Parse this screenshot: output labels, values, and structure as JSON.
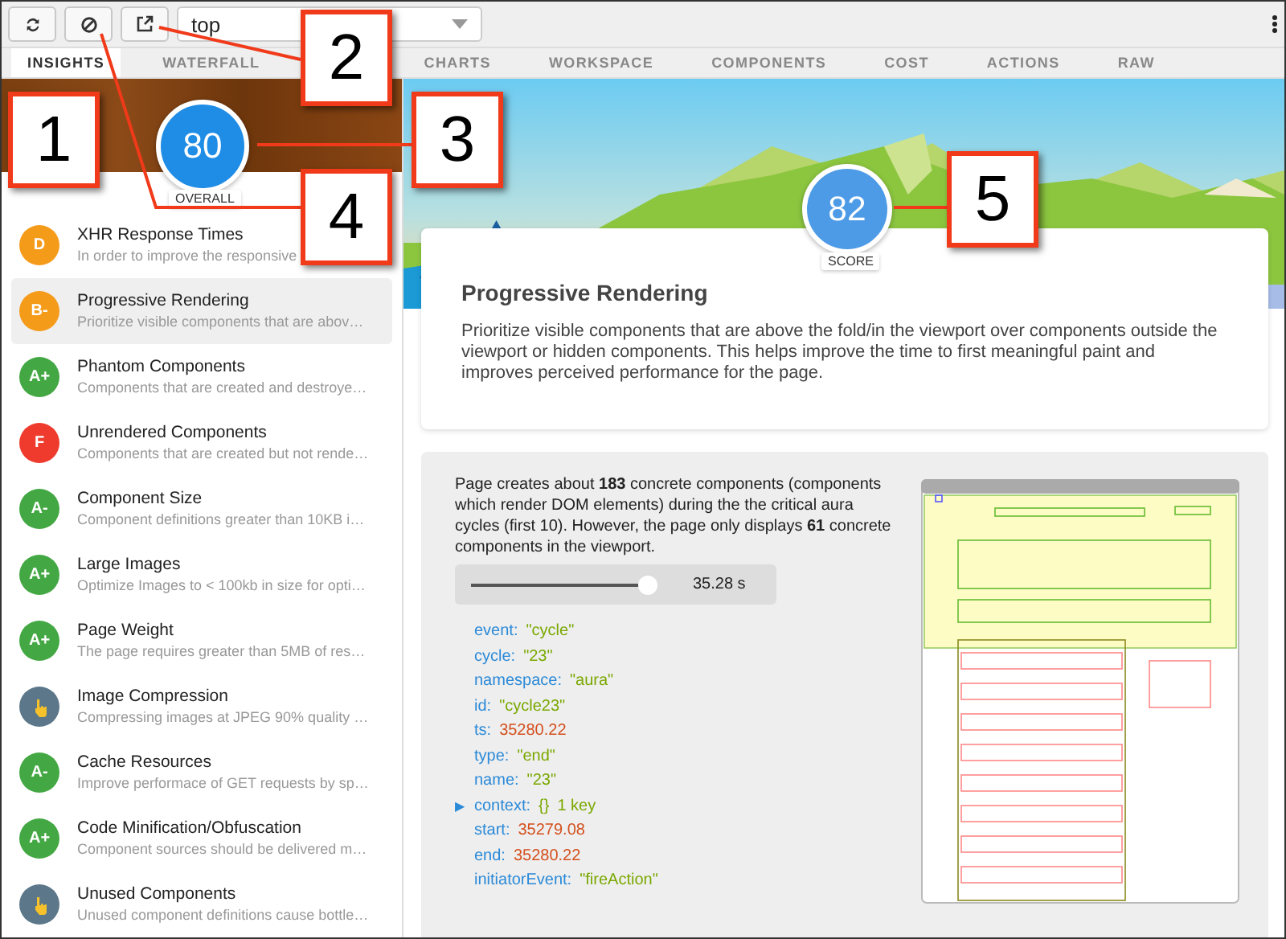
{
  "toolbar": {
    "buttons": [
      {
        "kind": "refresh"
      },
      {
        "kind": "block"
      },
      {
        "kind": "popout"
      }
    ],
    "frame_select": {
      "value": "top"
    }
  },
  "tabs": [
    {
      "label": "INSIGHTS",
      "selected": true
    },
    {
      "label": "WATERFALL",
      "selected": false
    },
    {
      "label": "CHARTS",
      "selected": false
    },
    {
      "label": "WORKSPACE",
      "selected": false
    },
    {
      "label": "COMPONENTS",
      "selected": false
    },
    {
      "label": "COST",
      "selected": false
    },
    {
      "label": "ACTIONS",
      "selected": false
    },
    {
      "label": "RAW",
      "selected": false
    }
  ],
  "overall": {
    "score": "80",
    "label": "OVERALL"
  },
  "insights": [
    {
      "kind": "grade",
      "grade": "D",
      "color": "#f59b1a",
      "title": "XHR Response Times",
      "desc": "In order to improve the responsive",
      "selected": false
    },
    {
      "kind": "grade",
      "grade": "B-",
      "color": "#f59b1a",
      "title": "Progressive Rendering",
      "desc": "Prioritize visible components that are abov…",
      "selected": true
    },
    {
      "kind": "grade",
      "grade": "A+",
      "color": "#43a843",
      "title": "Phantom Components",
      "desc": "Components that are created and destroye…",
      "selected": false
    },
    {
      "kind": "grade",
      "grade": "F",
      "color": "#ef3b2d",
      "title": "Unrendered Components",
      "desc": "Components that are created but not rende…",
      "selected": false
    },
    {
      "kind": "grade",
      "grade": "A-",
      "color": "#43a843",
      "title": "Component Size",
      "desc": "Component definitions greater than 10KB i…",
      "selected": false
    },
    {
      "kind": "grade",
      "grade": "A+",
      "color": "#43a843",
      "title": "Large Images",
      "desc": "Optimize Images to < 100kb in size for opti…",
      "selected": false
    },
    {
      "kind": "grade",
      "grade": "A+",
      "color": "#43a843",
      "title": "Page Weight",
      "desc": "The page requires greater than 5MB of res…",
      "selected": false
    },
    {
      "kind": "hand",
      "color": "#5b7789",
      "title": "Image Compression",
      "desc": "Compressing images at JPEG 90% quality …",
      "selected": false
    },
    {
      "kind": "grade",
      "grade": "A-",
      "color": "#43a843",
      "title": "Cache Resources",
      "desc": "Improve performace of GET requests by sp…",
      "selected": false
    },
    {
      "kind": "grade",
      "grade": "A+",
      "color": "#43a843",
      "title": "Code Minification/Obfuscation",
      "desc": "Component sources should be delivered m…",
      "selected": false
    },
    {
      "kind": "hand",
      "color": "#5b7789",
      "title": "Unused Components",
      "desc": "Unused component definitions cause bottle…",
      "selected": false
    }
  ],
  "detail": {
    "score": "82",
    "score_label": "SCORE",
    "title": "Progressive Rendering",
    "description": "Prioritize visible components that are above the fold/in the viewport over components outside the viewport or hidden components. This helps improve the time to first meaningful paint and improves perceived performance for the page.",
    "summary": "Page creates about **183** concrete components (components which render DOM elements) during the the critical aura cycles (first 10). However, the page only displays **61** concrete components in the viewport.",
    "slider": {
      "level": 1,
      "reading": "35.28 s"
    },
    "properties": [
      {
        "key": "event:",
        "kind": "string",
        "value": "\"cycle\""
      },
      {
        "key": "cycle:",
        "kind": "string",
        "value": "\"23\""
      },
      {
        "key": "namespace:",
        "kind": "string",
        "value": "\"aura\""
      },
      {
        "key": "id:",
        "kind": "string",
        "value": "\"cycle23\""
      },
      {
        "key": "ts:",
        "kind": "number",
        "value": "35280.22"
      },
      {
        "key": "type:",
        "kind": "string",
        "value": "\"end\""
      },
      {
        "key": "name:",
        "kind": "string",
        "value": "\"23\""
      },
      {
        "key": "context:",
        "kind": "object",
        "value": "{}",
        "count": "1 key",
        "marker": "▶",
        "expanded": false
      },
      {
        "key": "start:",
        "kind": "number",
        "value": "35279.08"
      },
      {
        "key": "end:",
        "kind": "number",
        "value": "35280.22"
      },
      {
        "key": "initiatorEvent:",
        "kind": "string",
        "value": "\"fireAction\""
      }
    ]
  },
  "callouts": [
    {
      "label": "1"
    },
    {
      "label": "2"
    },
    {
      "label": "3"
    },
    {
      "label": "4"
    },
    {
      "label": "5"
    }
  ]
}
